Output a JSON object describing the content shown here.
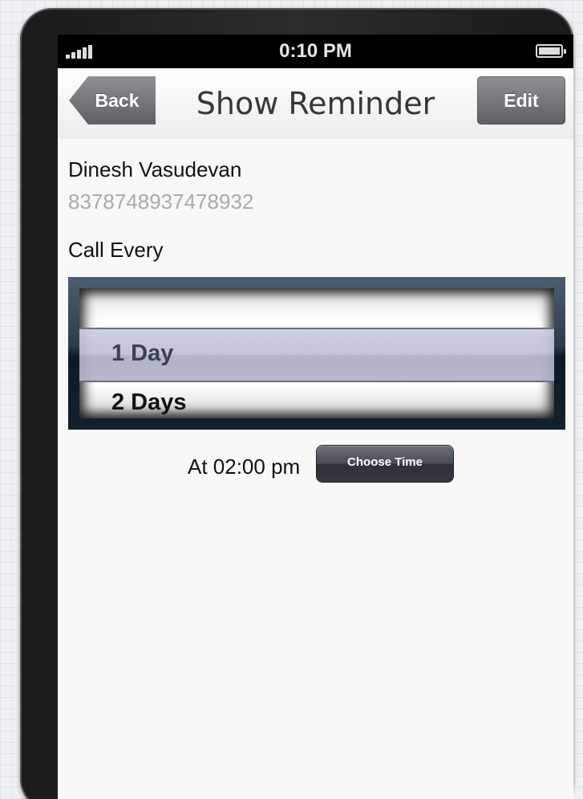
{
  "status_bar": {
    "time": "0:10 PM",
    "signal_bars": 5,
    "battery_level": 1.0
  },
  "nav": {
    "back_label": "Back",
    "title": "Show Reminder",
    "edit_label": "Edit"
  },
  "contact": {
    "name": "Dinesh Vasudevan",
    "phone": "8378748937478932"
  },
  "reminder": {
    "call_every_label": "Call Every",
    "picker_options": [
      "1 Day",
      "2 Days"
    ],
    "picker_selected": "1 Day",
    "time_label": "At 02:00 pm",
    "choose_time_label": "Choose Time"
  },
  "colors": {
    "nav_button": "#76787c",
    "picker_frame": "#2d3c4d",
    "choose_time_button": "#41464d"
  }
}
